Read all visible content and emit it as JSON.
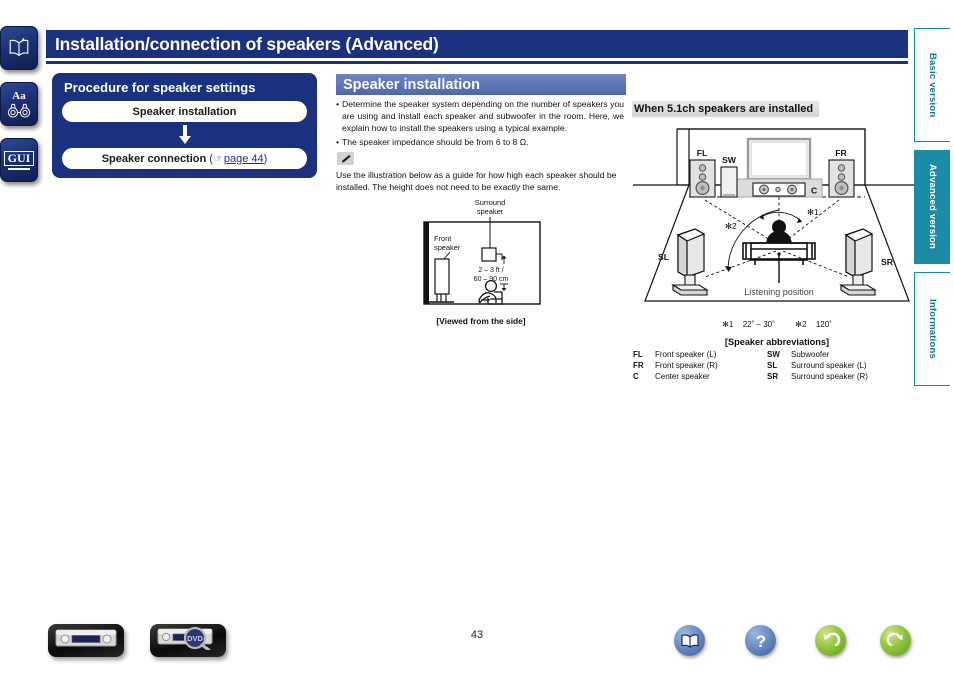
{
  "header": {
    "title": "Installation/connection of speakers (Advanced)",
    "page_number": "43"
  },
  "left_rail": [
    {
      "name": "book-icon",
      "label": "Manual"
    },
    {
      "name": "font-size-icon",
      "label": "Aa"
    },
    {
      "name": "gui-icon",
      "label": "GUI"
    }
  ],
  "procedure": {
    "title": "Procedure for speaker settings",
    "step1": "Speaker installation",
    "step2_label": "Speaker connection",
    "step2_ref_open": "(",
    "step2_ref_page": "page 44",
    "step2_ref_close": ")"
  },
  "speaker_installation": {
    "section_title": "Speaker installation",
    "bullets": [
      "Determine the speaker system depending on the number of speakers you are using and install each speaker and subwoofer in the room. Here, we explain how to install the speakers using a typical example.",
      "The speaker impedance should be from 6 to 8 Ω."
    ],
    "note_icon": "pencil-icon",
    "note_text": "Use the illustration below as a guide for how high each speaker should be installed. The height does not need to be exactly the same."
  },
  "side_view": {
    "surround_label_line1": "Surround",
    "surround_label_line2": "speaker",
    "front_label_line1": "Front",
    "front_label_line2": "speaker",
    "height_line1": "2 – 3 ft /",
    "height_line2": "60 – 90 cm",
    "caption": "[Viewed from the side]"
  },
  "room_51": {
    "heading": "When 5.1ch speakers are installed",
    "labels": {
      "fl": "FL",
      "fr": "FR",
      "sw": "SW",
      "c": "C",
      "sl": "SL",
      "sr": "SR",
      "listening_position": "Listening position",
      "star1": "✻1",
      "star2": "✻2"
    },
    "angles": {
      "star1_mark": "✻1",
      "star1_value": "22˚ – 30˚",
      "star2_mark": "✻2",
      "star2_value": "120˚"
    },
    "abbr_title": "[Speaker abbreviations]",
    "abbreviations": [
      {
        "key": "FL",
        "value": "Front speaker (L)",
        "key2": "SW",
        "value2": "Subwoofer"
      },
      {
        "key": "FR",
        "value": "Front speaker (R)",
        "key2": "SL",
        "value2": "Surround speaker (L)"
      },
      {
        "key": "C",
        "value": "Center speaker",
        "key2": "SR",
        "value2": "Surround speaker (R)"
      }
    ]
  },
  "right_tabs": [
    {
      "label": "Basic version",
      "active": false
    },
    {
      "label": "Advanced version",
      "active": true
    },
    {
      "label": "Informations",
      "active": false
    }
  ],
  "footer": {
    "device_button_1": "receiver-front-icon",
    "device_button_2": "receiver-zoom-icon",
    "nav": [
      {
        "name": "book-icon"
      },
      {
        "name": "question-icon"
      },
      {
        "name": "back-arrow-icon"
      },
      {
        "name": "forward-arrow-icon"
      }
    ]
  },
  "colors": {
    "title_navy": "#1a3180",
    "section_blue": "#4f68ab",
    "tab_teal": "#1b8ca6",
    "green": "#93c73f"
  }
}
